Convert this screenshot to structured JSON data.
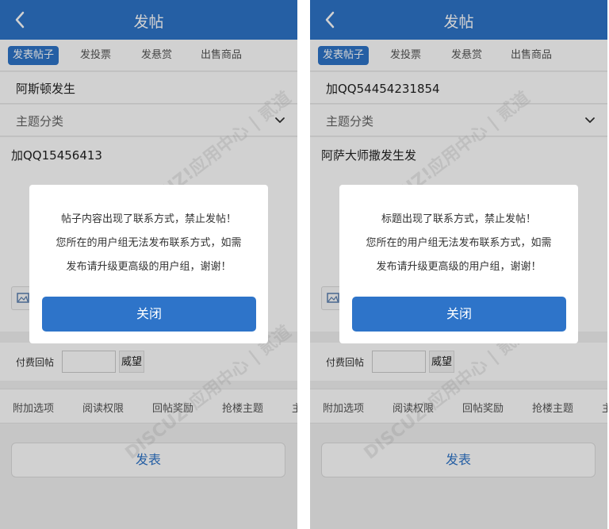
{
  "colors": {
    "accent": "#2e74c9",
    "overlay": "rgba(0,0,0,0.18)"
  },
  "icons": {
    "back": "chevron-left-icon",
    "category": "chevron-down-icon",
    "image": "image-icon"
  },
  "left": {
    "header": {
      "title": "发帖"
    },
    "tabs": [
      "发表帖子",
      "发投票",
      "发悬赏",
      "出售商品"
    ],
    "title_value": "阿斯顿发生",
    "category_label": "主题分类",
    "content_value": "加QQ15456413",
    "pay": {
      "label": "付费回帖",
      "unit": "威望"
    },
    "options": [
      "附加选项",
      "阅读权限",
      "回帖奖励",
      "抢楼主题",
      "主"
    ],
    "publish_label": "发表",
    "modal": {
      "line1": "帖子内容出现了联系方式，禁止发帖！",
      "line2": "您所在的用户组无法发布联系方式，如需",
      "line3": "发布请升级更高级的用户组，谢谢！",
      "close_label": "关闭"
    }
  },
  "right": {
    "header": {
      "title": "发帖"
    },
    "tabs": [
      "发表帖子",
      "发投票",
      "发悬赏",
      "出售商品"
    ],
    "title_value": "加QQ54454231854",
    "category_label": "主题分类",
    "content_value": "阿萨大师撒发生发",
    "pay": {
      "label": "付费回帖",
      "unit": "威望"
    },
    "options": [
      "附加选项",
      "阅读权限",
      "回帖奖励",
      "抢楼主题",
      "主"
    ],
    "publish_label": "发表",
    "modal": {
      "line1": "标题出现了联系方式，禁止发帖！",
      "line2": "您所在的用户组无法发布联系方式，如需",
      "line3": "发布请升级更高级的用户组，谢谢！",
      "close_label": "关闭"
    }
  },
  "watermark": "DISCUZ!应用中心 addon.dismall.com 贰道"
}
